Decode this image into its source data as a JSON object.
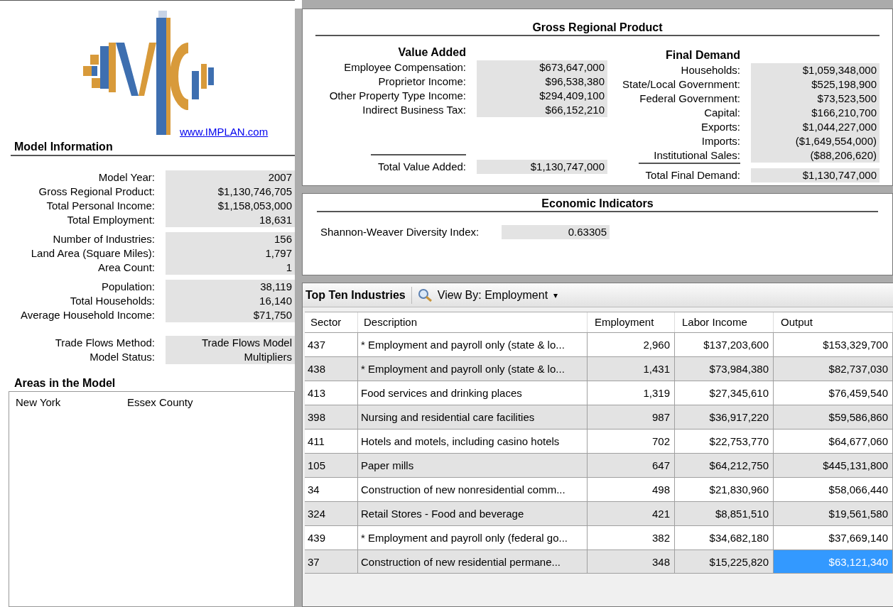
{
  "logo": {
    "link": "www.IMPLAN.com"
  },
  "model_information": {
    "title": "Model Information",
    "groups": [
      [
        {
          "label": "Model Year:",
          "value": "2007"
        },
        {
          "label": "Gross Regional Product:",
          "value": "$1,130,746,705"
        },
        {
          "label": "Total Personal Income:",
          "value": "$1,158,053,000"
        },
        {
          "label": "Total Employment:",
          "value": "18,631"
        }
      ],
      [
        {
          "label": "Number of Industries:",
          "value": "156"
        },
        {
          "label": "Land Area (Square Miles):",
          "value": "1,797"
        },
        {
          "label": "Area Count:",
          "value": "1"
        }
      ],
      [
        {
          "label": "Population:",
          "value": "38,119"
        },
        {
          "label": "Total Households:",
          "value": "16,140"
        },
        {
          "label": "Average Household Income:",
          "value": "$71,750"
        }
      ],
      [
        {
          "label": "Trade Flows Method:",
          "value": "Trade Flows Model"
        },
        {
          "label": "Model Status:",
          "value": "Multipliers"
        }
      ]
    ]
  },
  "areas": {
    "title": "Areas in the Model",
    "items": [
      {
        "state": "New York",
        "county": "Essex County"
      }
    ]
  },
  "gross_regional_product": {
    "title": "Gross Regional Product",
    "value_added": {
      "title": "Value Added",
      "items": [
        {
          "label": "Employee Compensation:",
          "value": "$673,647,000"
        },
        {
          "label": "Proprietor Income:",
          "value": "$96,538,380"
        },
        {
          "label": "Other Property Type Income:",
          "value": "$294,409,100"
        },
        {
          "label": "Indirect Business Tax:",
          "value": "$66,152,210"
        }
      ],
      "total": {
        "label": "Total Value Added:",
        "value": "$1,130,747,000"
      }
    },
    "final_demand": {
      "title": "Final Demand",
      "items": [
        {
          "label": "Households:",
          "value": "$1,059,348,000"
        },
        {
          "label": "State/Local Government:",
          "value": "$525,198,900"
        },
        {
          "label": "Federal Government:",
          "value": "$73,523,500"
        },
        {
          "label": "Capital:",
          "value": "$166,210,700"
        },
        {
          "label": "Exports:",
          "value": "$1,044,227,000"
        },
        {
          "label": "Imports:",
          "value": "($1,649,554,000)"
        },
        {
          "label": "Institutional Sales:",
          "value": "($88,206,620)"
        }
      ],
      "total": {
        "label": "Total Final Demand:",
        "value": "$1,130,747,000"
      }
    }
  },
  "economic_indicators": {
    "title": "Economic Indicators",
    "items": [
      {
        "label": "Shannon-Weaver Diversity Index:",
        "value": "0.63305"
      }
    ]
  },
  "top_industries": {
    "title": "Top Ten Industries",
    "view_by": "View By: Employment",
    "caret": "▾",
    "columns": [
      "Sector",
      "Description",
      "Employment",
      "Labor Income",
      "Output"
    ],
    "rows": [
      {
        "sector": "437",
        "description": "* Employment and payroll only (state & lo...",
        "employment": "2,960",
        "labor_income": "$137,203,600",
        "output": "$153,329,700",
        "output_selected": false
      },
      {
        "sector": "438",
        "description": "* Employment and payroll only (state & lo...",
        "employment": "1,431",
        "labor_income": "$73,984,380",
        "output": "$82,737,030",
        "output_selected": false
      },
      {
        "sector": "413",
        "description": "Food services and drinking places",
        "employment": "1,319",
        "labor_income": "$27,345,610",
        "output": "$76,459,540",
        "output_selected": false
      },
      {
        "sector": "398",
        "description": "Nursing and residential care facilities",
        "employment": "987",
        "labor_income": "$36,917,220",
        "output": "$59,586,860",
        "output_selected": false
      },
      {
        "sector": "411",
        "description": "Hotels and motels, including casino hotels",
        "employment": "702",
        "labor_income": "$22,753,770",
        "output": "$64,677,060",
        "output_selected": false
      },
      {
        "sector": "105",
        "description": "Paper mills",
        "employment": "647",
        "labor_income": "$64,212,750",
        "output": "$445,131,800",
        "output_selected": false
      },
      {
        "sector": "34",
        "description": "Construction of new nonresidential comm...",
        "employment": "498",
        "labor_income": "$21,830,960",
        "output": "$58,066,440",
        "output_selected": false
      },
      {
        "sector": "324",
        "description": "Retail Stores - Food and beverage",
        "employment": "421",
        "labor_income": "$8,851,510",
        "output": "$19,561,580",
        "output_selected": false
      },
      {
        "sector": "439",
        "description": "* Employment and payroll only (federal go...",
        "employment": "382",
        "labor_income": "$34,682,180",
        "output": "$37,669,140",
        "output_selected": false
      },
      {
        "sector": "37",
        "description": "Construction of new residential permane...",
        "employment": "348",
        "labor_income": "$15,225,820",
        "output": "$63,121,340",
        "output_selected": true
      }
    ]
  }
}
